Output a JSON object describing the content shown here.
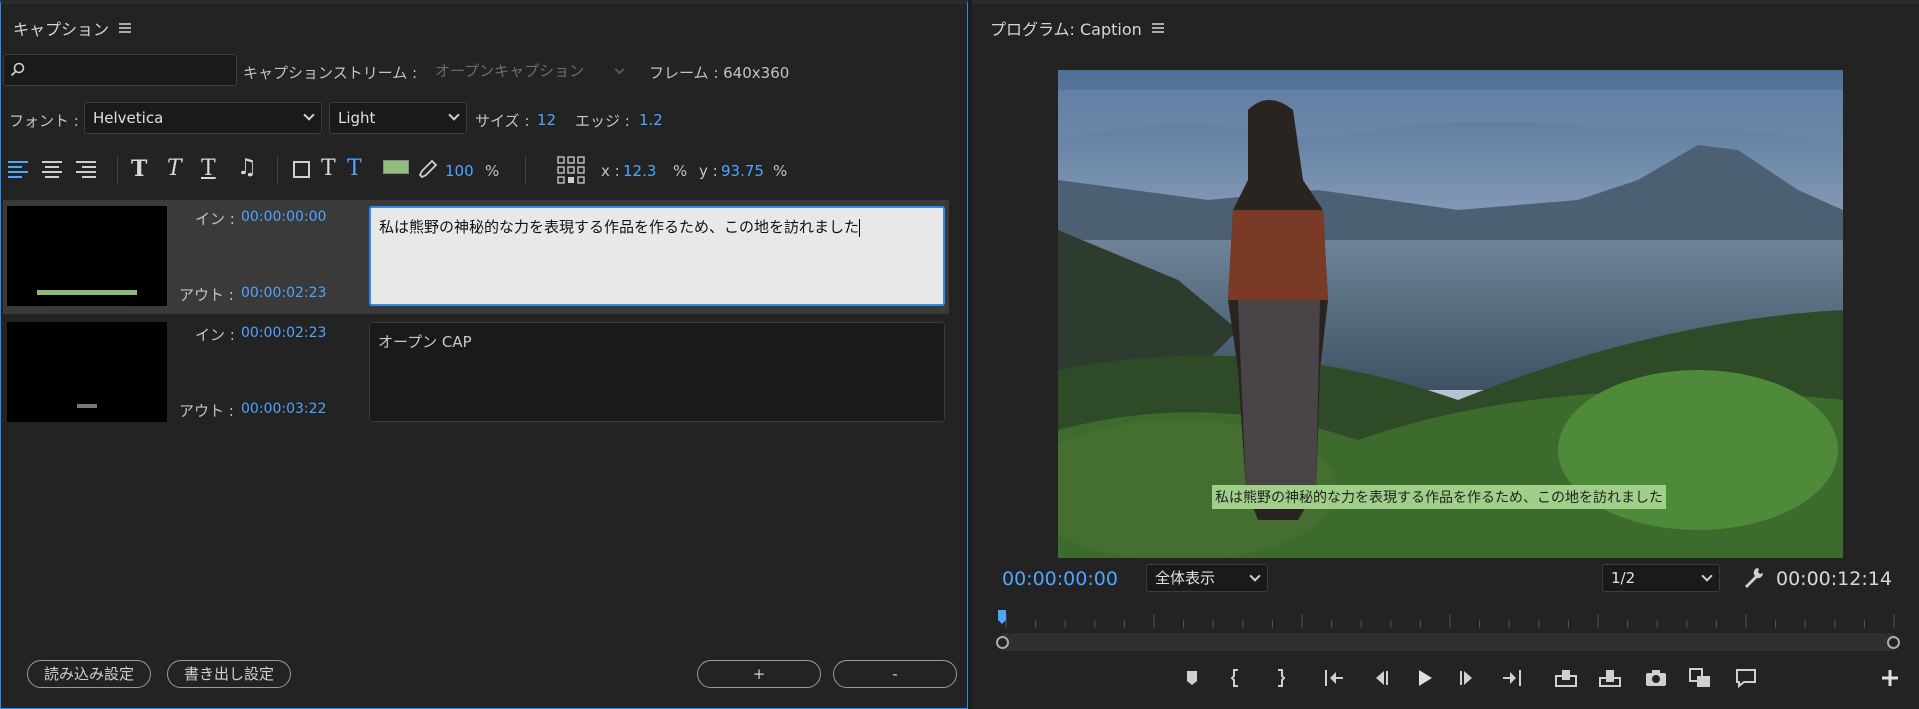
{
  "caption_panel": {
    "title": "キャプション",
    "search": {
      "placeholder": "",
      "value": ""
    },
    "stream_label": "キャプションストリーム :",
    "stream_value": "オープンキャプション",
    "frame_label": "フレーム : 640x360",
    "font_label": "フォント :",
    "font_value": "Helvetica",
    "weight_value": "Light",
    "size_label": "サイズ :",
    "size_value": "12",
    "edge_label": "エッジ :",
    "edge_value": "1.2",
    "opacity_value": "100",
    "percent": "%",
    "x_label": "x :",
    "x_value": "12.3",
    "y_label": "y :",
    "y_value": "93.75",
    "highlight_color": "#8fbf7a",
    "captions": [
      {
        "in_label": "イン :",
        "in_tc": "00:00:00:00",
        "out_label": "アウト :",
        "out_tc": "00:00:02:23",
        "text": "私は熊野の神秘的な力を表現する作品を作るため、この地を訪れました"
      },
      {
        "in_label": "イン :",
        "in_tc": "00:00:02:23",
        "out_label": "アウト :",
        "out_tc": "00:00:03:22",
        "text": "オープン CAP"
      }
    ],
    "import_settings": "読み込み設定",
    "export_settings": "書き出し設定",
    "add_button": "+",
    "remove_button": "-"
  },
  "program_panel": {
    "title": "プログラム: Caption",
    "subtitle": "私は熊野の神秘的な力を表現する作品を作るため、この地を訪れました",
    "current_tc": "00:00:00:00",
    "zoom_value": "全体表示",
    "resolution_value": "1/2",
    "duration_tc": "00:00:12:14"
  },
  "colors": {
    "accent": "#4fa4ff",
    "selection_border": "#2d8ceb"
  }
}
